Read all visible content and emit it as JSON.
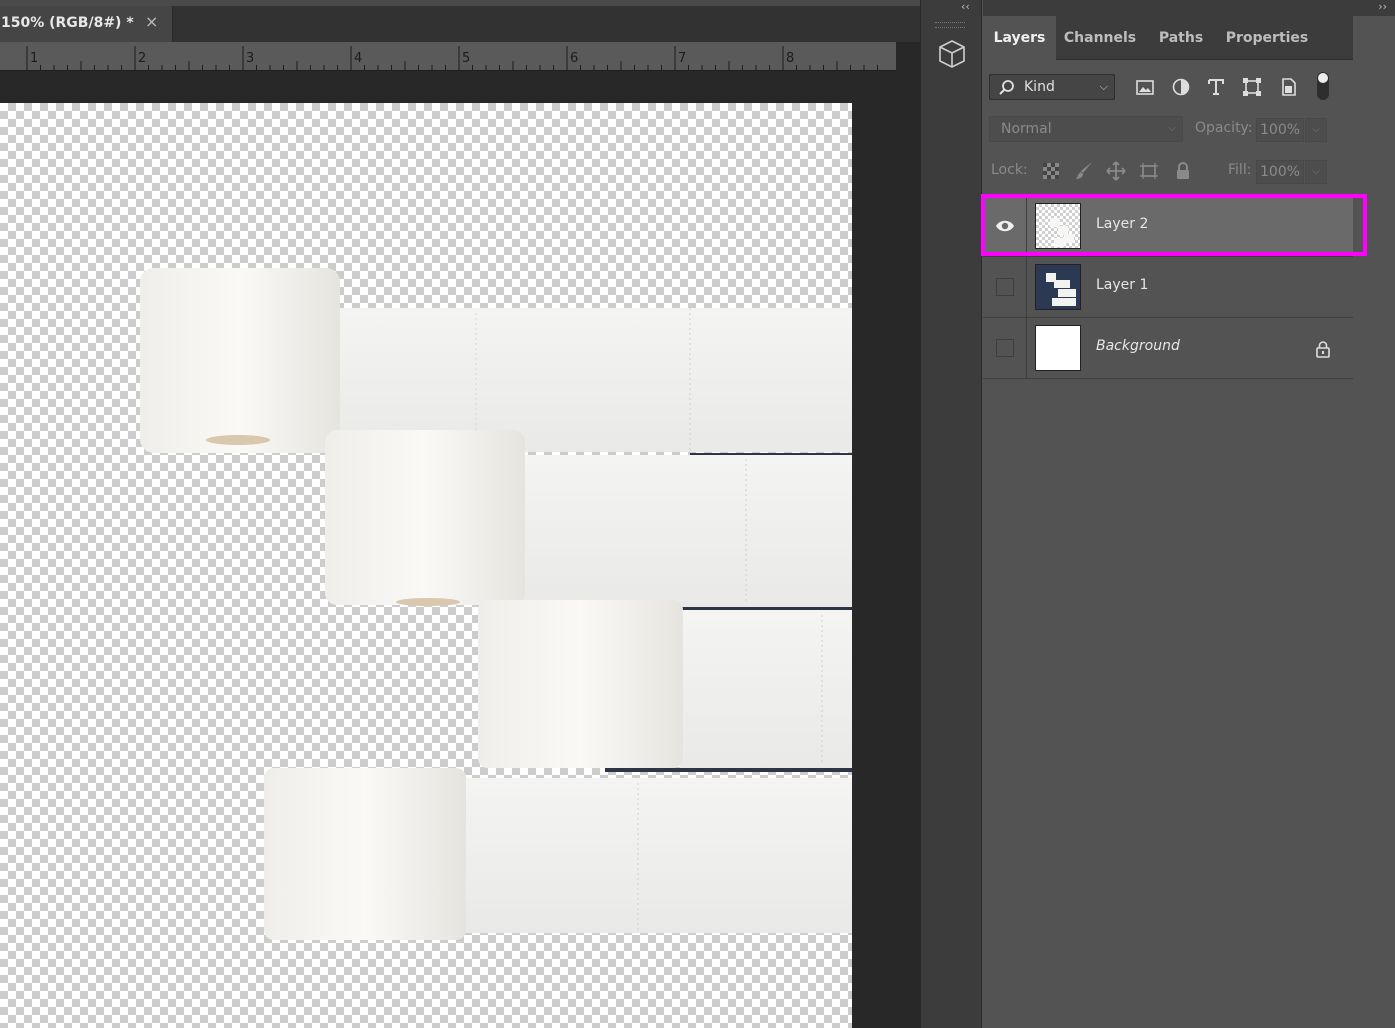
{
  "document": {
    "tab_title": "150% (RGB/8#) *",
    "tab_close": "×",
    "ruler_labels": [
      "1",
      "2",
      "3",
      "4",
      "5",
      "6",
      "7",
      "8"
    ]
  },
  "middle_dock": {
    "collapse_glyph": "‹‹"
  },
  "panel": {
    "expand_glyph": "››",
    "tabs": [
      {
        "label": "Layers",
        "active": true
      },
      {
        "label": "Channels",
        "active": false
      },
      {
        "label": "Paths",
        "active": false
      },
      {
        "label": "Properties",
        "active": false
      }
    ],
    "filter": {
      "kind_label": "Kind",
      "filter_icons": [
        "image-filter-icon",
        "adjustment-filter-icon",
        "type-filter-icon",
        "shape-filter-icon",
        "smart-object-filter-icon"
      ]
    },
    "blend_mode": "Normal",
    "opacity_label": "Opacity:",
    "opacity_value": "100%",
    "lock_label": "Lock:",
    "fill_label": "Fill:",
    "fill_value": "100%",
    "lock_icons": [
      "lock-transparent-pixels-icon",
      "lock-image-pixels-icon",
      "lock-position-icon",
      "lock-artboard-icon",
      "lock-all-icon"
    ]
  },
  "layers": [
    {
      "name": "Layer 2",
      "visible": true,
      "selected": true,
      "italic": false,
      "locked": false
    },
    {
      "name": "Layer 1",
      "visible": false,
      "selected": false,
      "italic": false,
      "locked": false
    },
    {
      "name": "Background",
      "visible": false,
      "selected": false,
      "italic": true,
      "locked": true
    }
  ],
  "colors": {
    "highlight": "#ff00ff",
    "panel_bg": "#535353",
    "canvas_dark": "#282828"
  }
}
